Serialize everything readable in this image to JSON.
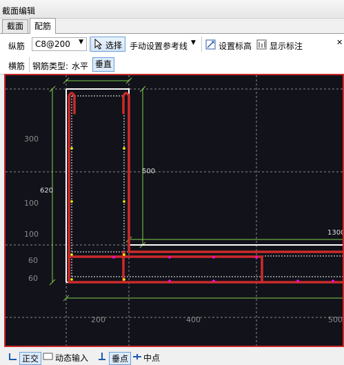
{
  "window": {
    "title": "截面编辑"
  },
  "tabs": [
    {
      "label": "截面",
      "active": false
    },
    {
      "label": "配筋",
      "active": true
    }
  ],
  "toolbar1": {
    "longitudinal_label": "纵筋",
    "rebar_spec": "C8@200",
    "select_label": "选择",
    "manual_ref_line_label": "手动设置参考线",
    "set_elevation_label": "设置标高",
    "show_annotation_label": "显示标注"
  },
  "toolbar2": {
    "transverse_label": "横筋",
    "rebar_type_label": "钢筋类型:",
    "rebar_type_value": "水平",
    "vertical_button_label": "垂直"
  },
  "drawing": {
    "dims": {
      "d300": "300",
      "d620": "620",
      "d100a": "100",
      "d100b": "100",
      "d60a": "60",
      "d60b": "60",
      "d500": "500",
      "d1300": "1300",
      "b200": "200",
      "b400": "400",
      "b500": "500"
    },
    "colors": {
      "background": "#12121a",
      "rebar": "#cc2a2a",
      "outline": "#ffffff",
      "dimension": "#7fd04a",
      "grid": "#8c8c8c",
      "nodes": "#ff00ff",
      "endpoints": "#ffff00"
    }
  },
  "statusbar": {
    "orthogonal": "正交",
    "dynamic_input": "动态输入",
    "perpendicular": "垂点",
    "midpoint": "中点"
  }
}
